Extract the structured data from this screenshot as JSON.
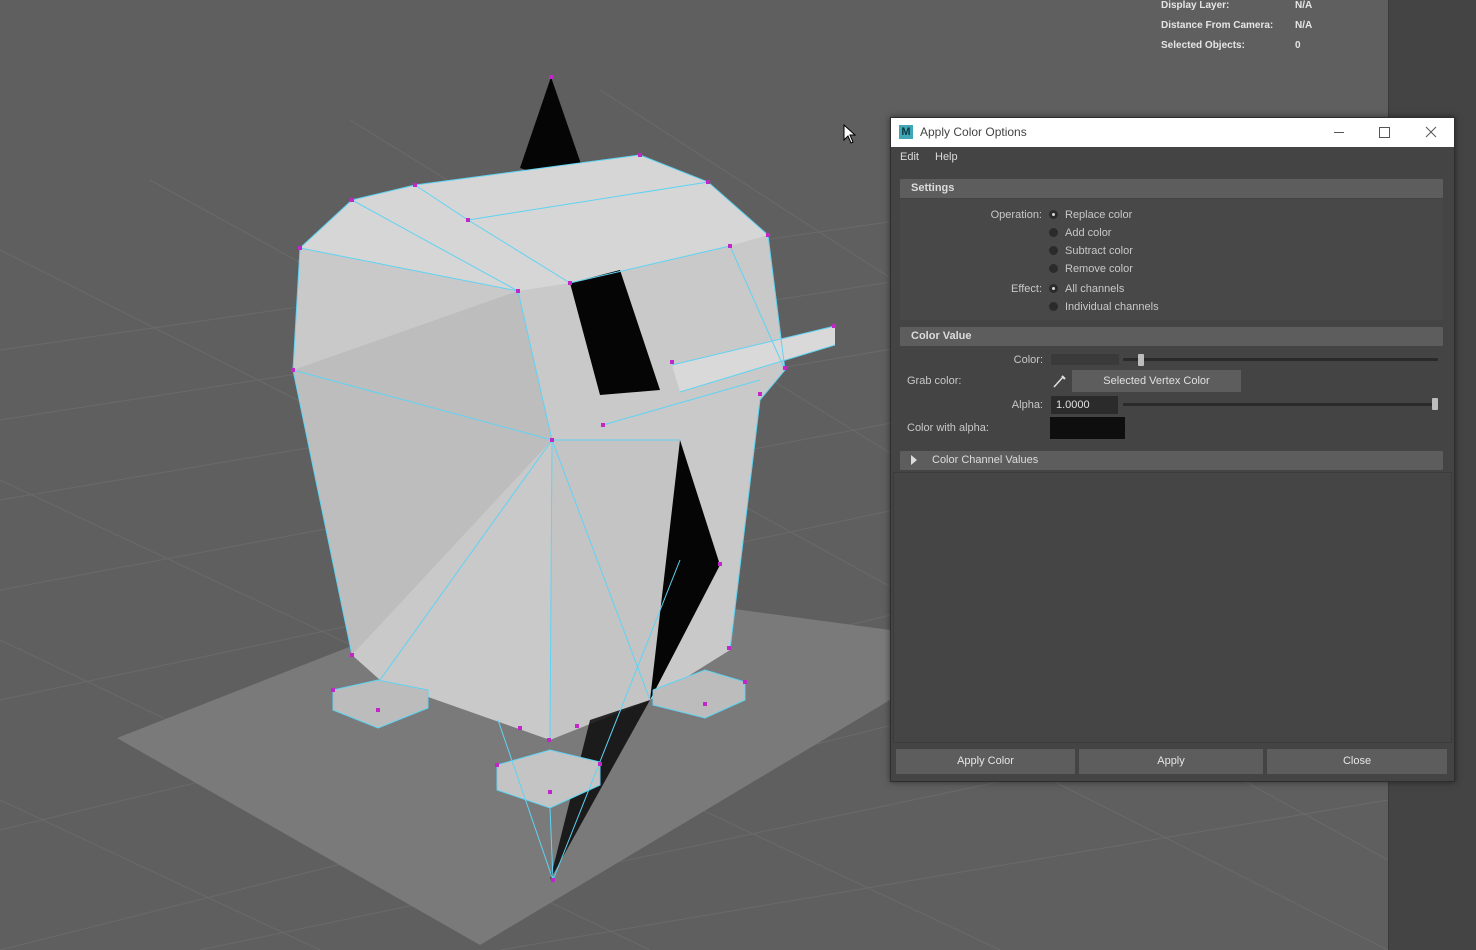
{
  "hud": {
    "display_layer_label": "Display Layer:",
    "display_layer_value": "N/A",
    "distance_label": "Distance From Camera:",
    "distance_value": "N/A",
    "selected_objects_label": "Selected Objects:",
    "selected_objects_value": "0"
  },
  "dialog": {
    "title": "Apply Color Options",
    "app_icon_letter": "M",
    "menu": {
      "edit": "Edit",
      "help": "Help"
    },
    "settings": {
      "header": "Settings",
      "operation_label": "Operation:",
      "operation_options": [
        "Replace color",
        "Add color",
        "Subtract color",
        "Remove color"
      ],
      "operation_selected": "Replace color",
      "effect_label": "Effect:",
      "effect_options": [
        "All channels",
        "Individual channels"
      ],
      "effect_selected": "All channels"
    },
    "color_value": {
      "header": "Color Value",
      "color_label": "Color:",
      "color_swatch": "#3a3a3a",
      "color_slider_fraction": 0.05,
      "grab_color_label": "Grab color:",
      "grab_button_label": "Selected Vertex Color",
      "eyedropper_icon": "eyedropper-icon",
      "alpha_label": "Alpha:",
      "alpha_value": "1.0000",
      "alpha_slider_fraction": 1.0,
      "color_with_alpha_label": "Color with alpha:",
      "color_with_alpha_swatch": "#0e0e0e"
    },
    "channels": {
      "header": "Color Channel Values",
      "expanded": false
    },
    "buttons": {
      "apply_color": "Apply Color",
      "apply": "Apply",
      "close": "Close"
    }
  },
  "colors": {
    "viewport_bg": "#5f5f5f",
    "mesh_wire": "#5fd3f3",
    "vertex": "#c026c8",
    "dialog_bg": "#444444",
    "section_header": "#5d5d5d"
  }
}
